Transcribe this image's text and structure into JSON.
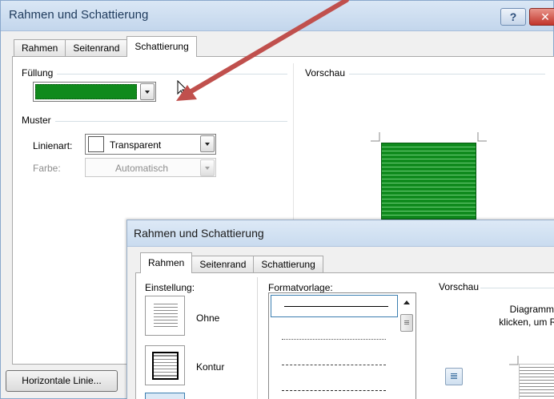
{
  "dialog_back": {
    "title": "Rahmen und Schattierung",
    "help_glyph": "?",
    "close_glyph": "✕",
    "tabs": [
      {
        "label": "Rahmen",
        "active": false
      },
      {
        "label": "Seitenrand",
        "active": false
      },
      {
        "label": "Schattierung",
        "active": true
      }
    ],
    "fill": {
      "label": "Füllung",
      "color": "#108a1c"
    },
    "pattern": {
      "label": "Muster",
      "linestyle_label": "Linienart:",
      "linestyle_value": "Transparent",
      "color_label": "Farbe:",
      "color_value": "Automatisch"
    },
    "preview_label": "Vorschau",
    "horizontal_line_button": "Horizontale Linie..."
  },
  "dialog_front": {
    "title": "Rahmen und Schattierung",
    "tabs": [
      {
        "label": "Rahmen",
        "active": true
      },
      {
        "label": "Seitenrand",
        "active": false
      },
      {
        "label": "Schattierung",
        "active": false
      }
    ],
    "setting_label": "Einstellung:",
    "settings": [
      {
        "label": "Ohne"
      },
      {
        "label": "Kontur"
      }
    ],
    "style_label": "Formatvorlage:",
    "preview_label": "Vorschau",
    "preview_hint_line1": "Diagramm o",
    "preview_hint_line2": "klicken, um Ra"
  },
  "colors": {
    "arrow": "#c0504d",
    "fill_green": "#108a1c",
    "title_text": "#1e3a5c"
  },
  "icons": [
    "help-icon",
    "close-icon",
    "dropdown-arrow-icon",
    "mouse-cursor-icon",
    "annotation-arrow-icon",
    "scroll-up-icon"
  ]
}
